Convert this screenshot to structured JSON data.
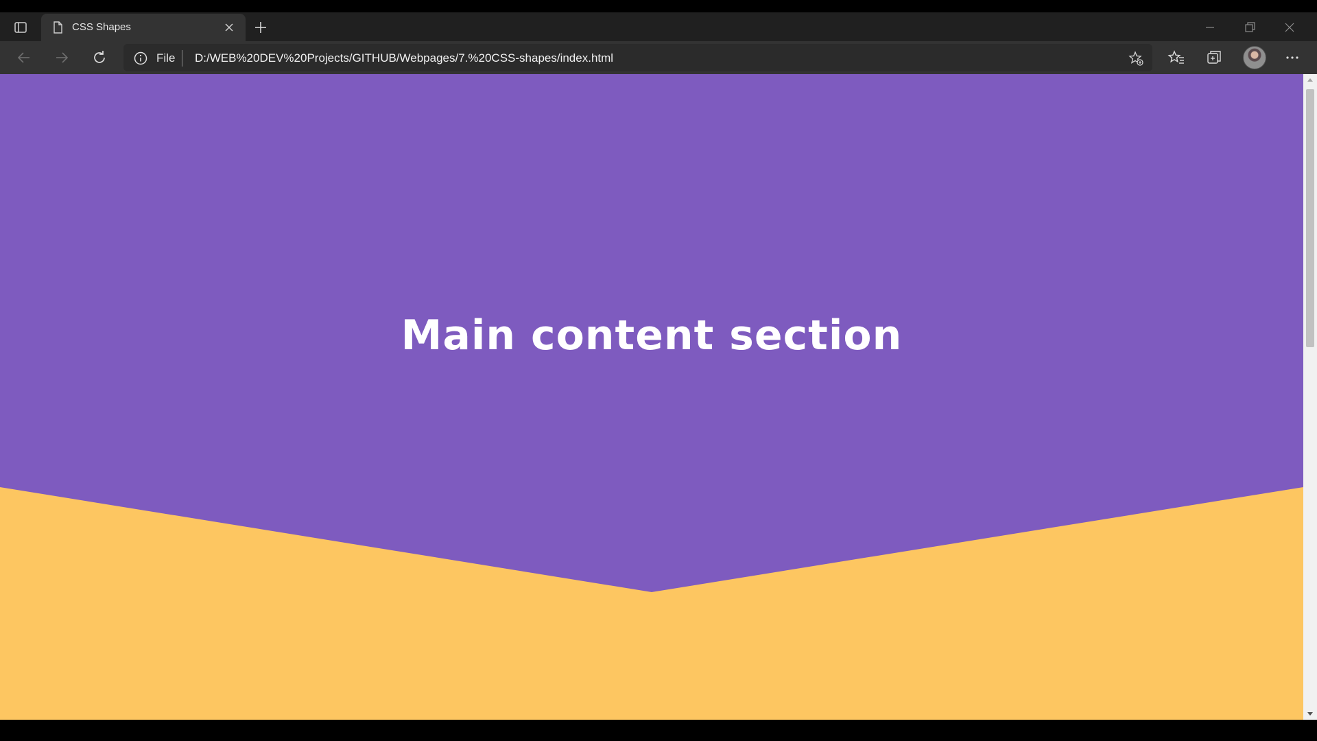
{
  "browser": {
    "tab": {
      "title": "CSS Shapes",
      "icon": "document-icon"
    },
    "address_bar": {
      "scheme_label": "File",
      "url": "D:/WEB%20DEV%20Projects/GITHUB/Webpages/7.%20CSS-shapes/index.html"
    },
    "icons": {
      "tab_actions": "tab-actions-icon",
      "close_tab": "close-icon",
      "new_tab": "plus-icon",
      "back": "back-arrow-icon",
      "forward": "forward-arrow-icon",
      "refresh": "refresh-icon",
      "site_info": "info-icon",
      "add_favorite": "star-add-icon",
      "favorites": "favorites-icon",
      "collections": "collections-icon",
      "more": "more-icon"
    }
  },
  "page": {
    "hero_title": "Main content section",
    "colors": {
      "hero_background": "#7e5bbf",
      "lower_background": "#fdc661",
      "hero_text": "#ffffff"
    }
  }
}
